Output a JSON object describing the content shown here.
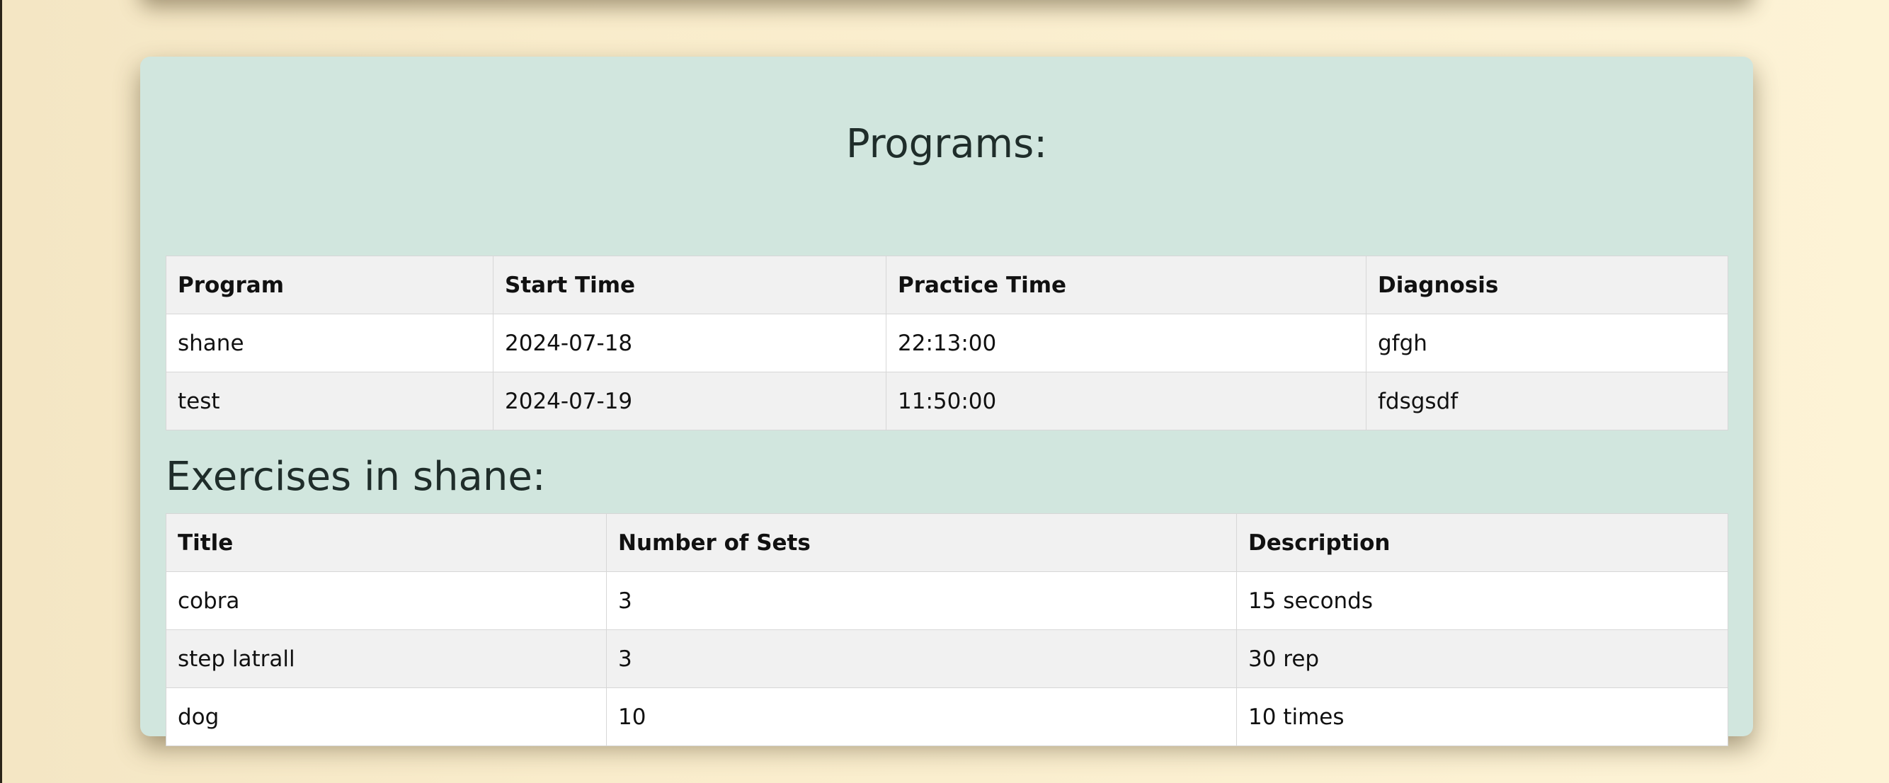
{
  "programs": {
    "title": "Programs:",
    "columns": [
      "Program",
      "Start Time",
      "Practice Time",
      "Diagnosis"
    ],
    "rows": [
      [
        "shane",
        "2024-07-18",
        "22:13:00",
        "gfgh"
      ],
      [
        "test",
        "2024-07-19",
        "11:50:00",
        "fdsgsdf"
      ]
    ]
  },
  "exercises": {
    "title": "Exercises in shane:",
    "columns": [
      "Title",
      "Number of Sets",
      "Description"
    ],
    "rows": [
      [
        "cobra",
        "3",
        "15 seconds"
      ],
      [
        "step latrall",
        "3",
        "30 rep"
      ],
      [
        "dog",
        "10",
        "10 times"
      ]
    ]
  },
  "colors": {
    "page_background": "#fdf3d6",
    "card_background": "#d1e6de",
    "table_header_background": "#f1f1f1",
    "row_odd_background": "#ffffff",
    "row_even_background": "#f1f1f1",
    "title_text": "#1f2d2a"
  }
}
